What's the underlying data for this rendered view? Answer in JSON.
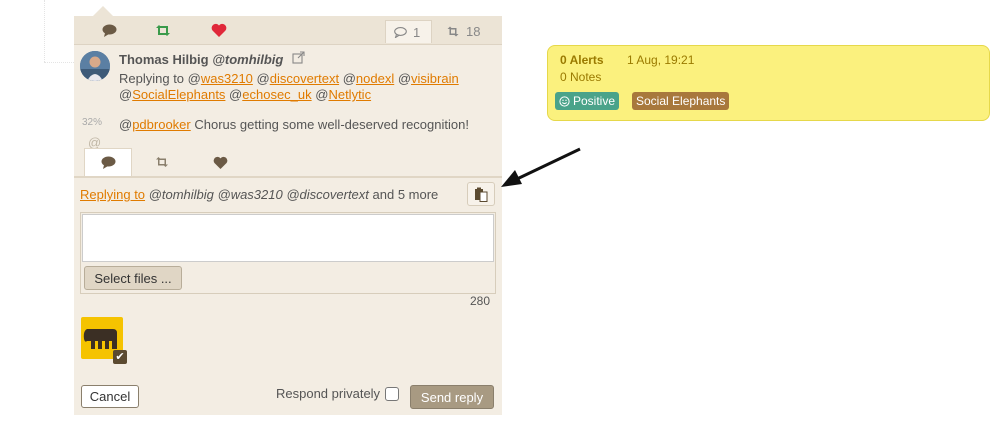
{
  "top_tabs": {
    "reply_count": "1",
    "retweet_count": "18"
  },
  "tweet": {
    "author_name": "Thomas Hilbig",
    "author_handle": "@tomhilbig",
    "score": "32%",
    "at_symbol": "@",
    "replying_to_prefix": "Replying to @",
    "mentions_line1": [
      {
        "prefix": "",
        "name": "was3210"
      },
      {
        "prefix": " @",
        "name": "discovertext"
      },
      {
        "prefix": " @",
        "name": "nodexl"
      },
      {
        "prefix": " @",
        "name": "visibrain"
      }
    ],
    "mentions_line2": [
      {
        "prefix": "@",
        "name": "SocialElephants"
      },
      {
        "prefix": " @",
        "name": "echosec_uk"
      },
      {
        "prefix": " @",
        "name": "Netlytic"
      }
    ],
    "body_mention": "pdbrooker",
    "body_at": "@",
    "body_text": " Chorus getting some well-deserved recognition!"
  },
  "reply": {
    "replying_to_link": "Replying to",
    "replying_to_handles": " @tomhilbig @was3210 @discovertext",
    "more_text": "  and 5 more",
    "textarea_value": "",
    "select_files_label": "Select files ...",
    "char_count": "280",
    "cancel_label": "Cancel",
    "respond_privately_label": "Respond privately",
    "respond_privately_checked": false,
    "send_label": "Send reply"
  },
  "note_box": {
    "alerts": "0 Alerts",
    "date": "1 Aug, 19:21",
    "notes": "0 Notes",
    "tags": [
      {
        "label": "Positive",
        "icon": "smiley-icon",
        "color": "#4aa38a"
      },
      {
        "label": "Social Elephants",
        "icon": "",
        "color": "#a8783c"
      }
    ]
  },
  "colors": {
    "accent_link": "#e07b00",
    "retweet_green": "#3a9a4a",
    "like_red": "#e0283a",
    "panel_bg": "#f3ede3",
    "note_bg": "#fbf17e"
  }
}
